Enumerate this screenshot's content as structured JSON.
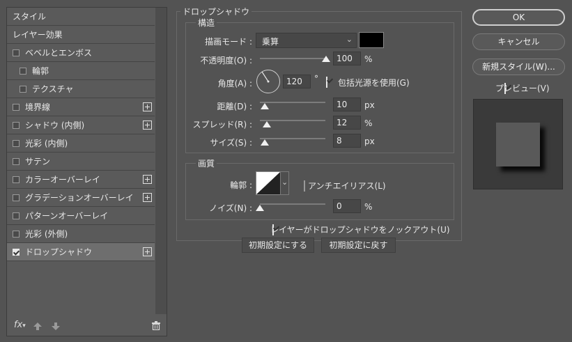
{
  "left_panel": {
    "items": [
      {
        "label": "スタイル"
      },
      {
        "label": "レイヤー効果"
      },
      {
        "label": "ベベルとエンボス"
      },
      {
        "label": "輪郭"
      },
      {
        "label": "テクスチャ"
      },
      {
        "label": "境界線"
      },
      {
        "label": "シャドウ (内側)"
      },
      {
        "label": "光彩 (内側)"
      },
      {
        "label": "サテン"
      },
      {
        "label": "カラーオーバーレイ"
      },
      {
        "label": "グラデーションオーバーレイ"
      },
      {
        "label": "パターンオーバーレイ"
      },
      {
        "label": "光彩 (外側)"
      },
      {
        "label": "ドロップシャドウ"
      }
    ],
    "fx_label": "fx",
    "checked_item": "ドロップシャドウ"
  },
  "drop_shadow": {
    "title": "ドロップシャドウ",
    "structure": {
      "title": "構造",
      "blend_mode_label": "描画モード :",
      "blend_mode_value": "乗算",
      "shadow_color": "#000000",
      "opacity_label": "不透明度(O) :",
      "opacity_value": "100",
      "opacity_unit": "%",
      "angle_label": "角度(A) :",
      "angle_value": "120",
      "angle_unit": "°",
      "global_light_label": "包括光源を使用(G)",
      "global_light_checked": true,
      "distance_label": "距離(D) :",
      "distance_value": "10",
      "distance_unit": "px",
      "spread_label": "スプレッド(R) :",
      "spread_value": "12",
      "spread_unit": "%",
      "size_label": "サイズ(S) :",
      "size_value": "8",
      "size_unit": "px"
    },
    "quality": {
      "title": "画質",
      "contour_label": "輪郭 :",
      "antialias_label": "アンチエイリアス(L)",
      "antialias_checked": false,
      "noise_label": "ノイズ(N) :",
      "noise_value": "0",
      "noise_unit": "%"
    },
    "knockout_label": "レイヤーがドロップシャドウをノックアウト(U)",
    "knockout_checked": true,
    "make_default_label": "初期設定にする",
    "reset_default_label": "初期設定に戻す"
  },
  "right_panel": {
    "ok_label": "OK",
    "cancel_label": "キャンセル",
    "new_style_label": "新規スタイル(W)...",
    "preview_label": "プレビュー(V)",
    "preview_checked": true
  },
  "colors": {
    "dialog_bg": "#535353",
    "selected_row": "#6e6e6e",
    "preview_bg": "#3a3a3a",
    "preview_swatch": "#595959"
  }
}
